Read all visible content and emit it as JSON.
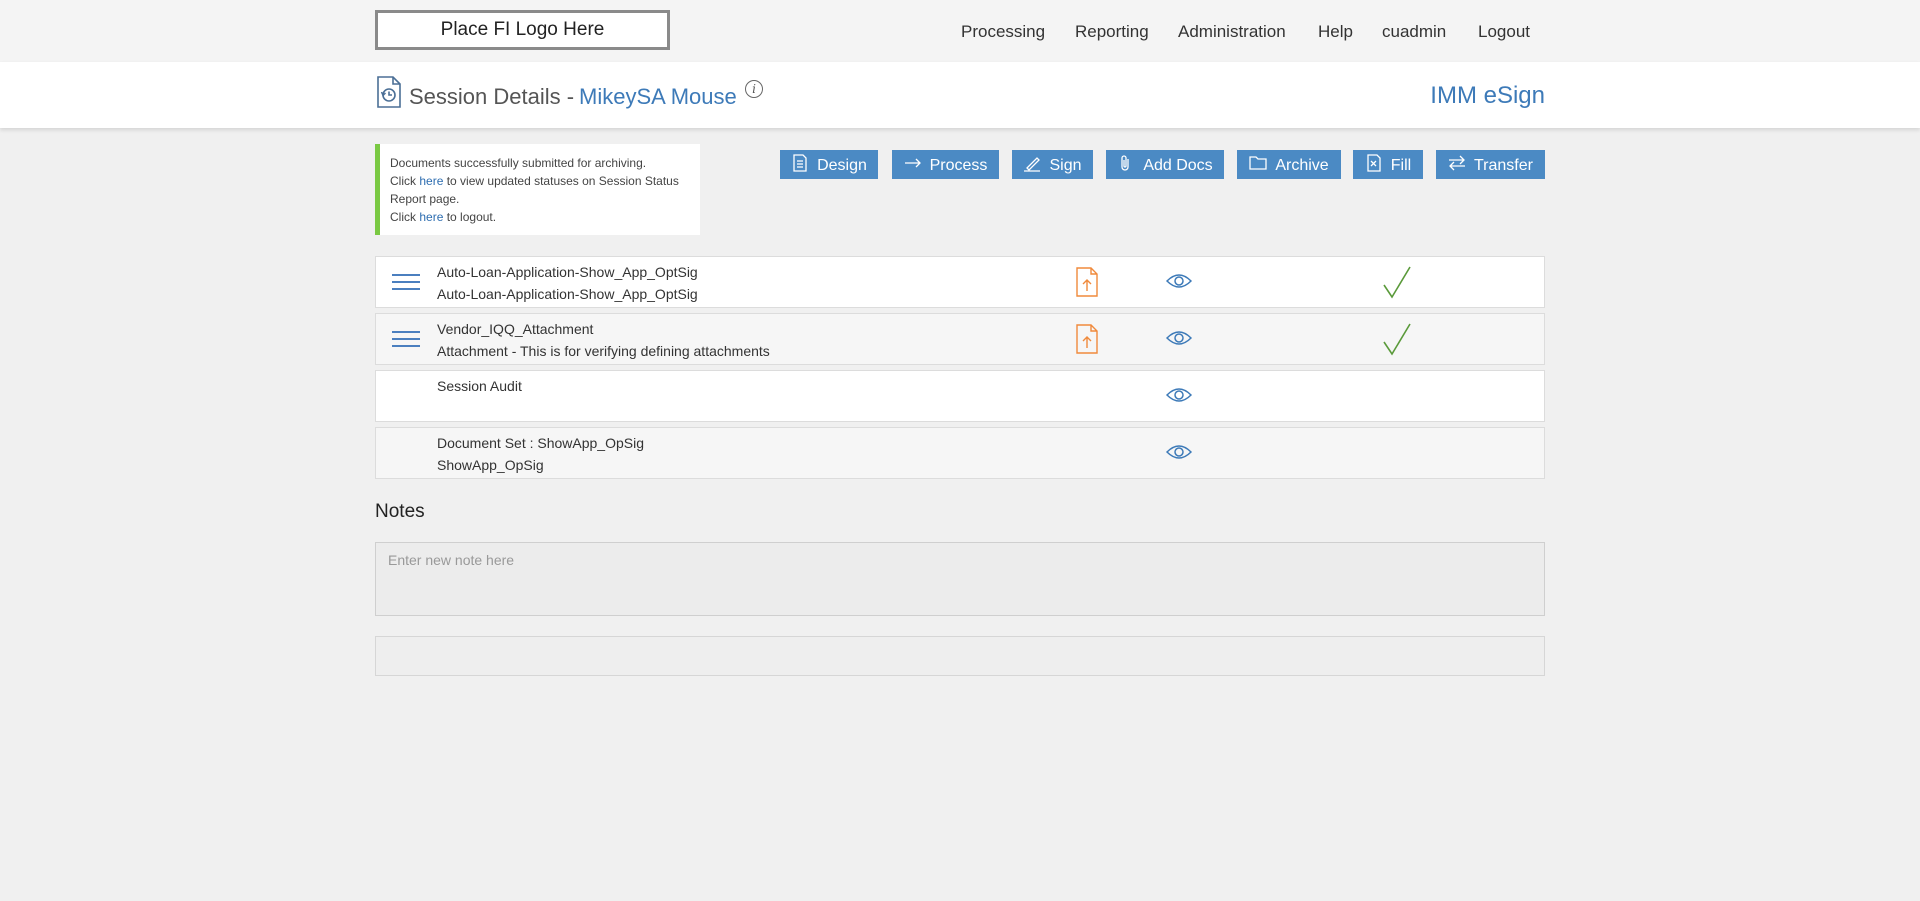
{
  "logo": {
    "text": "Place FI Logo Here"
  },
  "nav": {
    "processing": "Processing",
    "reporting": "Reporting",
    "administration": "Administration",
    "help": "Help",
    "user": "cuadmin",
    "logout": "Logout"
  },
  "header": {
    "title": "Session Details -",
    "customer": "MikeySA Mouse",
    "brand": "IMM eSign"
  },
  "message": {
    "line1": "Documents successfully submitted for archiving.",
    "line2_pre": "Click ",
    "line2_link": "here",
    "line2_post": " to view updated statuses on Session Status Report page.",
    "line3_pre": "Click ",
    "line3_link": "here",
    "line3_post": " to logout."
  },
  "toolbar": {
    "design": "Design",
    "process": "Process",
    "sign": "Sign",
    "add_docs": "Add Docs",
    "archive": "Archive",
    "fill": "Fill",
    "transfer": "Transfer"
  },
  "documents": [
    {
      "name": "Auto-Loan-Application-Show_App_OptSig",
      "description": "Auto-Loan-Application-Show_App_OptSig",
      "has_menu": true,
      "has_upload": true,
      "has_view": true,
      "completed": true
    },
    {
      "name": "Vendor_IQQ_Attachment",
      "description": "Attachment - This is for verifying defining attachments",
      "has_menu": true,
      "has_upload": true,
      "has_view": true,
      "completed": true
    },
    {
      "name": "Session Audit",
      "description": "",
      "has_menu": false,
      "has_upload": false,
      "has_view": true,
      "completed": false
    },
    {
      "name": "Document Set : ShowApp_OpSig",
      "description": "ShowApp_OpSig",
      "has_menu": false,
      "has_upload": false,
      "has_view": true,
      "completed": false
    }
  ],
  "notes": {
    "heading": "Notes",
    "placeholder": "Enter new note here"
  },
  "colors": {
    "accent": "#4b8ac4",
    "link": "#3d7ab8",
    "success_bar": "#7ac943",
    "check": "#5a9a3a",
    "upload": "#f08a3c"
  }
}
